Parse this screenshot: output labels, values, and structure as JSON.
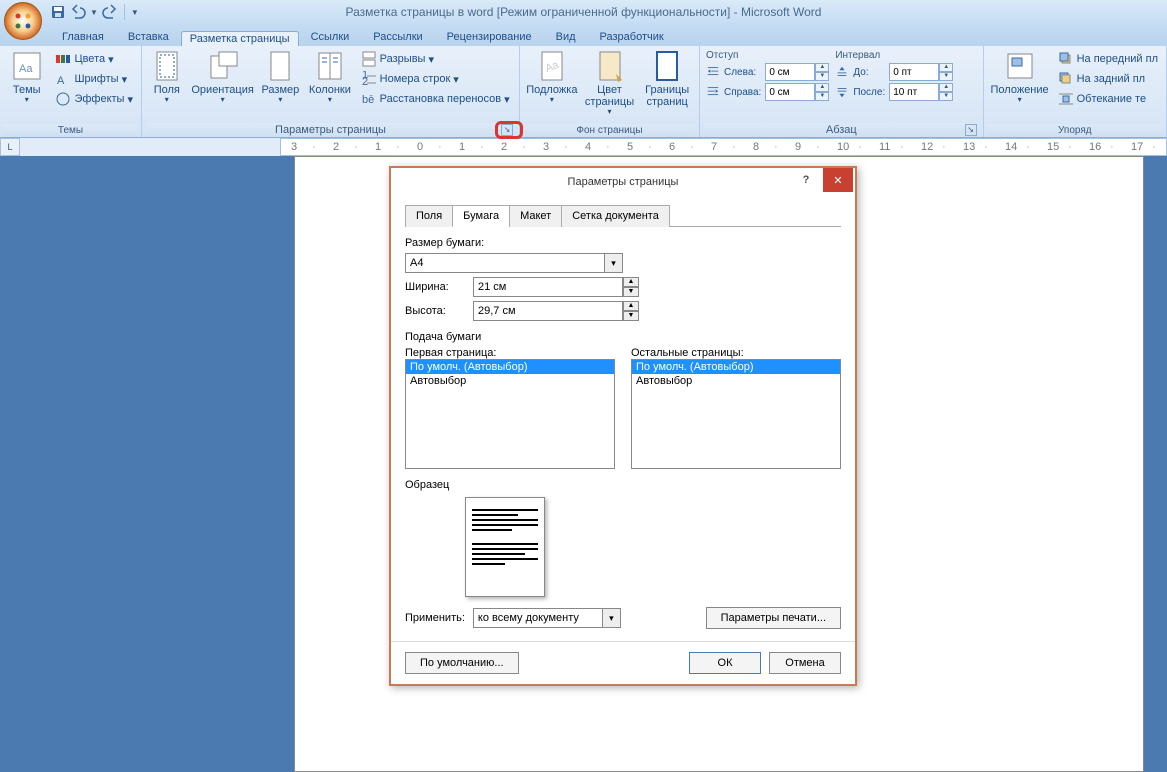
{
  "window": {
    "title": "Разметка страницы в word [Режим ограниченной функциональности] - Microsoft Word"
  },
  "tabs": [
    "Главная",
    "Вставка",
    "Разметка страницы",
    "Ссылки",
    "Рассылки",
    "Рецензирование",
    "Вид",
    "Разработчик"
  ],
  "ribbon": {
    "themes": {
      "label": "Темы",
      "btn": "Темы",
      "colors": "Цвета",
      "fonts": "Шрифты",
      "effects": "Эффекты"
    },
    "page_setup": {
      "label": "Параметры страницы",
      "margins": "Поля",
      "orientation": "Ориентация",
      "size": "Размер",
      "columns": "Колонки",
      "breaks": "Разрывы",
      "line_numbers": "Номера строк",
      "hyphenation": "Расстановка переносов"
    },
    "page_bg": {
      "label": "Фон страницы",
      "watermark": "Подложка",
      "color": "Цвет\nстраницы",
      "borders": "Границы\nстраниц"
    },
    "indent": {
      "hdr": "Отступ",
      "left": "Слева:",
      "right": "Справа:",
      "left_v": "0 см",
      "right_v": "0 см"
    },
    "spacing": {
      "hdr": "Интервал",
      "before": "До:",
      "after": "После:",
      "before_v": "0 пт",
      "after_v": "10 пт"
    },
    "paragraph_label": "Абзац",
    "arrange": {
      "position": "Положение",
      "front": "На передний пл",
      "back": "На задний пл",
      "wrap": "Обтекание те",
      "label": "Упоряд"
    }
  },
  "dialog": {
    "title": "Параметры страницы",
    "tabs": [
      "Поля",
      "Бумага",
      "Макет",
      "Сетка документа"
    ],
    "paper_size_lbl": "Размер бумаги:",
    "paper_size": "A4",
    "width_lbl": "Ширина:",
    "width": "21 см",
    "height_lbl": "Высота:",
    "height": "29,7 см",
    "feed_lbl": "Подача бумаги",
    "first_page": "Первая страница:",
    "other_pages": "Остальные страницы:",
    "items": [
      "По умолч. (Автовыбор)",
      "Автовыбор"
    ],
    "sample": "Образец",
    "apply_lbl": "Применить:",
    "apply_val": "ко всему документу",
    "print_opts": "Параметры печати...",
    "default": "По умолчанию...",
    "ok": "ОК",
    "cancel": "Отмена"
  }
}
